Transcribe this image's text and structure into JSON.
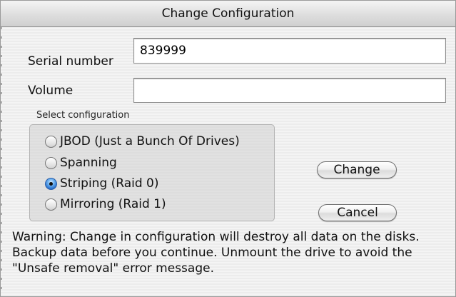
{
  "window": {
    "title": "Change Configuration"
  },
  "fields": {
    "serial_label": "Serial number",
    "serial_value": "839999",
    "volume_label": "Volume",
    "volume_value": ""
  },
  "configuration": {
    "group_label": "Select configuration",
    "options": [
      {
        "label": "JBOD (Just a Bunch Of Drives)",
        "selected": false
      },
      {
        "label": "Spanning",
        "selected": false
      },
      {
        "label": "Striping (Raid 0)",
        "selected": true
      },
      {
        "label": "Mirroring (Raid 1)",
        "selected": false
      }
    ]
  },
  "buttons": {
    "change_label": "Change",
    "cancel_label": "Cancel"
  },
  "warning_text": "Warning: Change in configuration will destroy all data on the disks. Backup data before you continue. Unmount the drive to avoid the \"Unsafe removal\" error message."
}
